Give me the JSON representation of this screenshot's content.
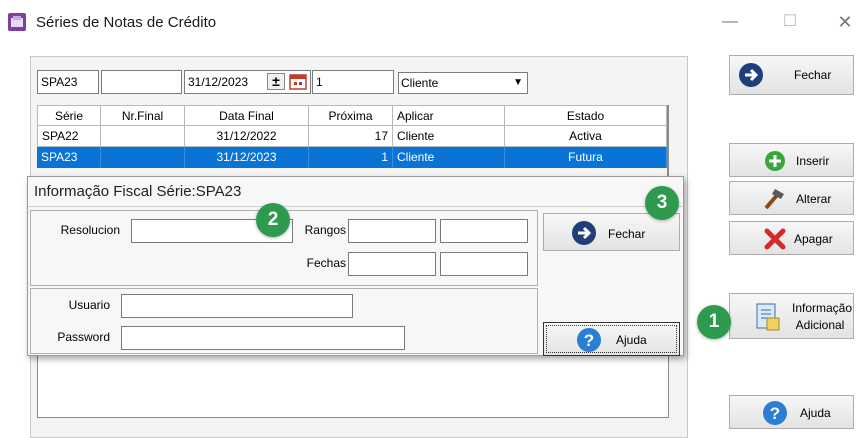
{
  "window": {
    "title": "Séries de Notas de Crédito",
    "minimize": "—",
    "maximize": "☐",
    "close": "✕"
  },
  "filters": {
    "serie": "SPA23",
    "nr_final": "",
    "data_final": "31/12/2023",
    "proxima": "1",
    "aplicar": "Cliente"
  },
  "table": {
    "columns": [
      "Série",
      "Nr.Final",
      "Data Final",
      "Próxima",
      "Aplicar",
      "Estado"
    ],
    "rows": [
      [
        "SPA22",
        "",
        "31/12/2022",
        "17",
        "Cliente",
        "Activa"
      ],
      [
        "SPA23",
        "",
        "31/12/2023",
        "1",
        "Cliente",
        "Futura"
      ]
    ],
    "selected_row": 1
  },
  "side_buttons": {
    "fechar": "Fechar",
    "inserir": "Inserir",
    "alterar": "Alterar",
    "apagar": "Apagar",
    "info_line1": "Informação",
    "info_line2": "Adicional",
    "ajuda": "Ajuda"
  },
  "dialog": {
    "title": "Informação Fiscal Série:SPA23",
    "resolucion_label": "Resolucion",
    "resolucion_value": "",
    "rangos_label": "Rangos",
    "fechas_label": "Fechas",
    "usuario_label": "Usuario",
    "usuario_value": "",
    "password_label": "Password",
    "password_value": "",
    "fechar": "Fechar",
    "ajuda": "Ajuda"
  },
  "badges": {
    "one": "1",
    "two": "2",
    "three": "3"
  },
  "colors": {
    "selection": "#0a74d6",
    "badge": "#2e9a4e",
    "arrow_icon": "#1f3f7a",
    "plus_icon": "#3aa53a",
    "delete_icon": "#d22b2b",
    "help_icon": "#2a7fd4"
  }
}
